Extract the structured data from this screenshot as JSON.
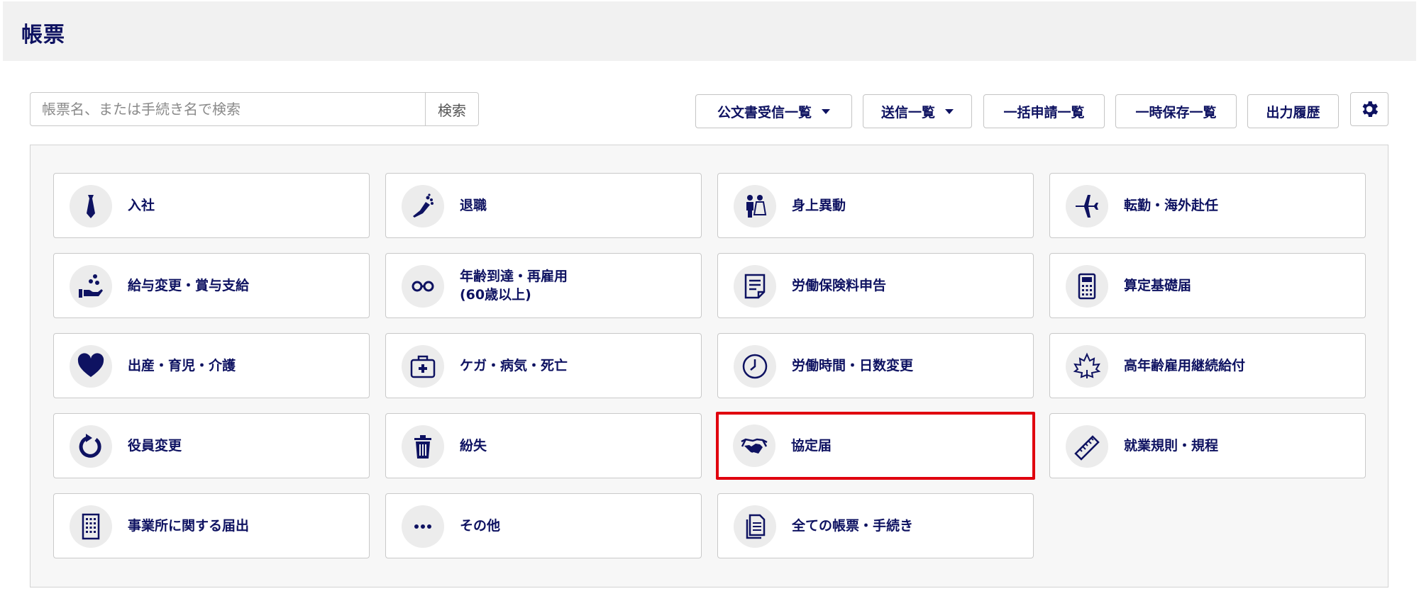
{
  "header": {
    "title": "帳票"
  },
  "search": {
    "placeholder": "帳票名、または手続き名で検索",
    "button_label": "検索"
  },
  "toolbar": {
    "official_docs": "公文書受信一覧",
    "sent_list": "送信一覧",
    "batch_list": "一括申請一覧",
    "saved_list": "一時保存一覧",
    "output_history": "出力履歴"
  },
  "tiles": [
    {
      "label": "入社",
      "icon": "necktie-icon"
    },
    {
      "label": "退職",
      "icon": "bouquet-icon"
    },
    {
      "label": "身上異動",
      "icon": "wedding-couple-icon"
    },
    {
      "label": "転勤・海外赴任",
      "icon": "airplane-icon"
    },
    {
      "label": "給与変更・賞与支給",
      "icon": "hand-coins-icon"
    },
    {
      "label": "年齢到達・再雇用\n(60歳以上)",
      "icon": "glasses-icon"
    },
    {
      "label": "労働保険料申告",
      "icon": "document-icon"
    },
    {
      "label": "算定基礎届",
      "icon": "calculator-icon"
    },
    {
      "label": "出産・育児・介護",
      "icon": "heart-icon"
    },
    {
      "label": "ケガ・病気・死亡",
      "icon": "first-aid-kit-icon"
    },
    {
      "label": "労働時間・日数変更",
      "icon": "clock-icon"
    },
    {
      "label": "高年齢雇用継続給付",
      "icon": "maple-leaf-icon"
    },
    {
      "label": "役員変更",
      "icon": "refresh-icon"
    },
    {
      "label": "紛失",
      "icon": "trash-icon"
    },
    {
      "label": "協定届",
      "icon": "handshake-icon",
      "highlighted": true
    },
    {
      "label": "就業規則・規程",
      "icon": "ruler-icon"
    },
    {
      "label": "事業所に関する届出",
      "icon": "building-icon"
    },
    {
      "label": "その他",
      "icon": "ellipsis-icon"
    },
    {
      "label": "全ての帳票・手続き",
      "icon": "documents-icon"
    }
  ],
  "colors": {
    "primary": "#0e1261",
    "highlight": "#e0000e",
    "panel_bg": "#f7f7f7"
  }
}
